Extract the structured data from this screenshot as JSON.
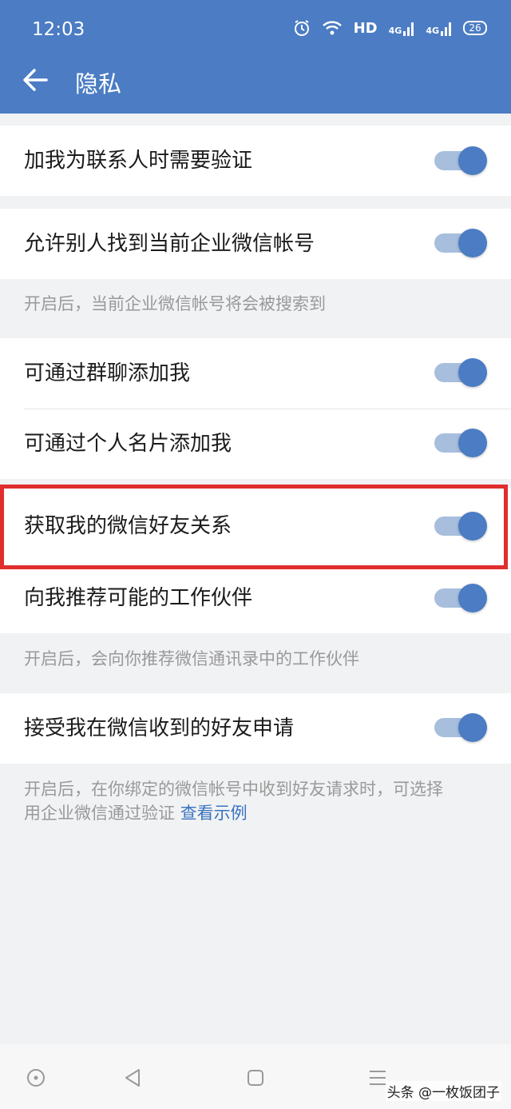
{
  "status_bar": {
    "time": "12:03",
    "hd_label": "HD",
    "network_1": "4G",
    "network_2": "4G",
    "battery": "26"
  },
  "header": {
    "title": "隐私"
  },
  "settings": {
    "verify_contact": {
      "label": "加我为联系人时需要验证",
      "enabled": true
    },
    "searchable": {
      "label": "允许别人找到当前企业微信帐号",
      "enabled": true,
      "hint": "开启后，当前企业微信帐号将会被搜索到"
    },
    "add_by_group": {
      "label": "可通过群聊添加我",
      "enabled": true
    },
    "add_by_card": {
      "label": "可通过个人名片添加我",
      "enabled": true
    },
    "wechat_friends": {
      "label": "获取我的微信好友关系",
      "enabled": true
    },
    "recommend_partners": {
      "label": "向我推荐可能的工作伙伴",
      "enabled": true,
      "hint": "开启后，会向你推荐微信通讯录中的工作伙伴"
    },
    "accept_requests": {
      "label": "接受我在微信收到的好友申请",
      "enabled": true,
      "hint_line1": "开启后，在你绑定的微信帐号中收到好友请求时，可选择",
      "hint_line2": "用企业微信通过验证",
      "hint_link": "查看示例"
    }
  },
  "colors": {
    "header_bg": "#4b7cc4",
    "toggle_on": "#4b7cc4",
    "highlight": "#e02d2d",
    "link": "#3a74c0"
  },
  "watermark": "头条 @一枚饭团子"
}
